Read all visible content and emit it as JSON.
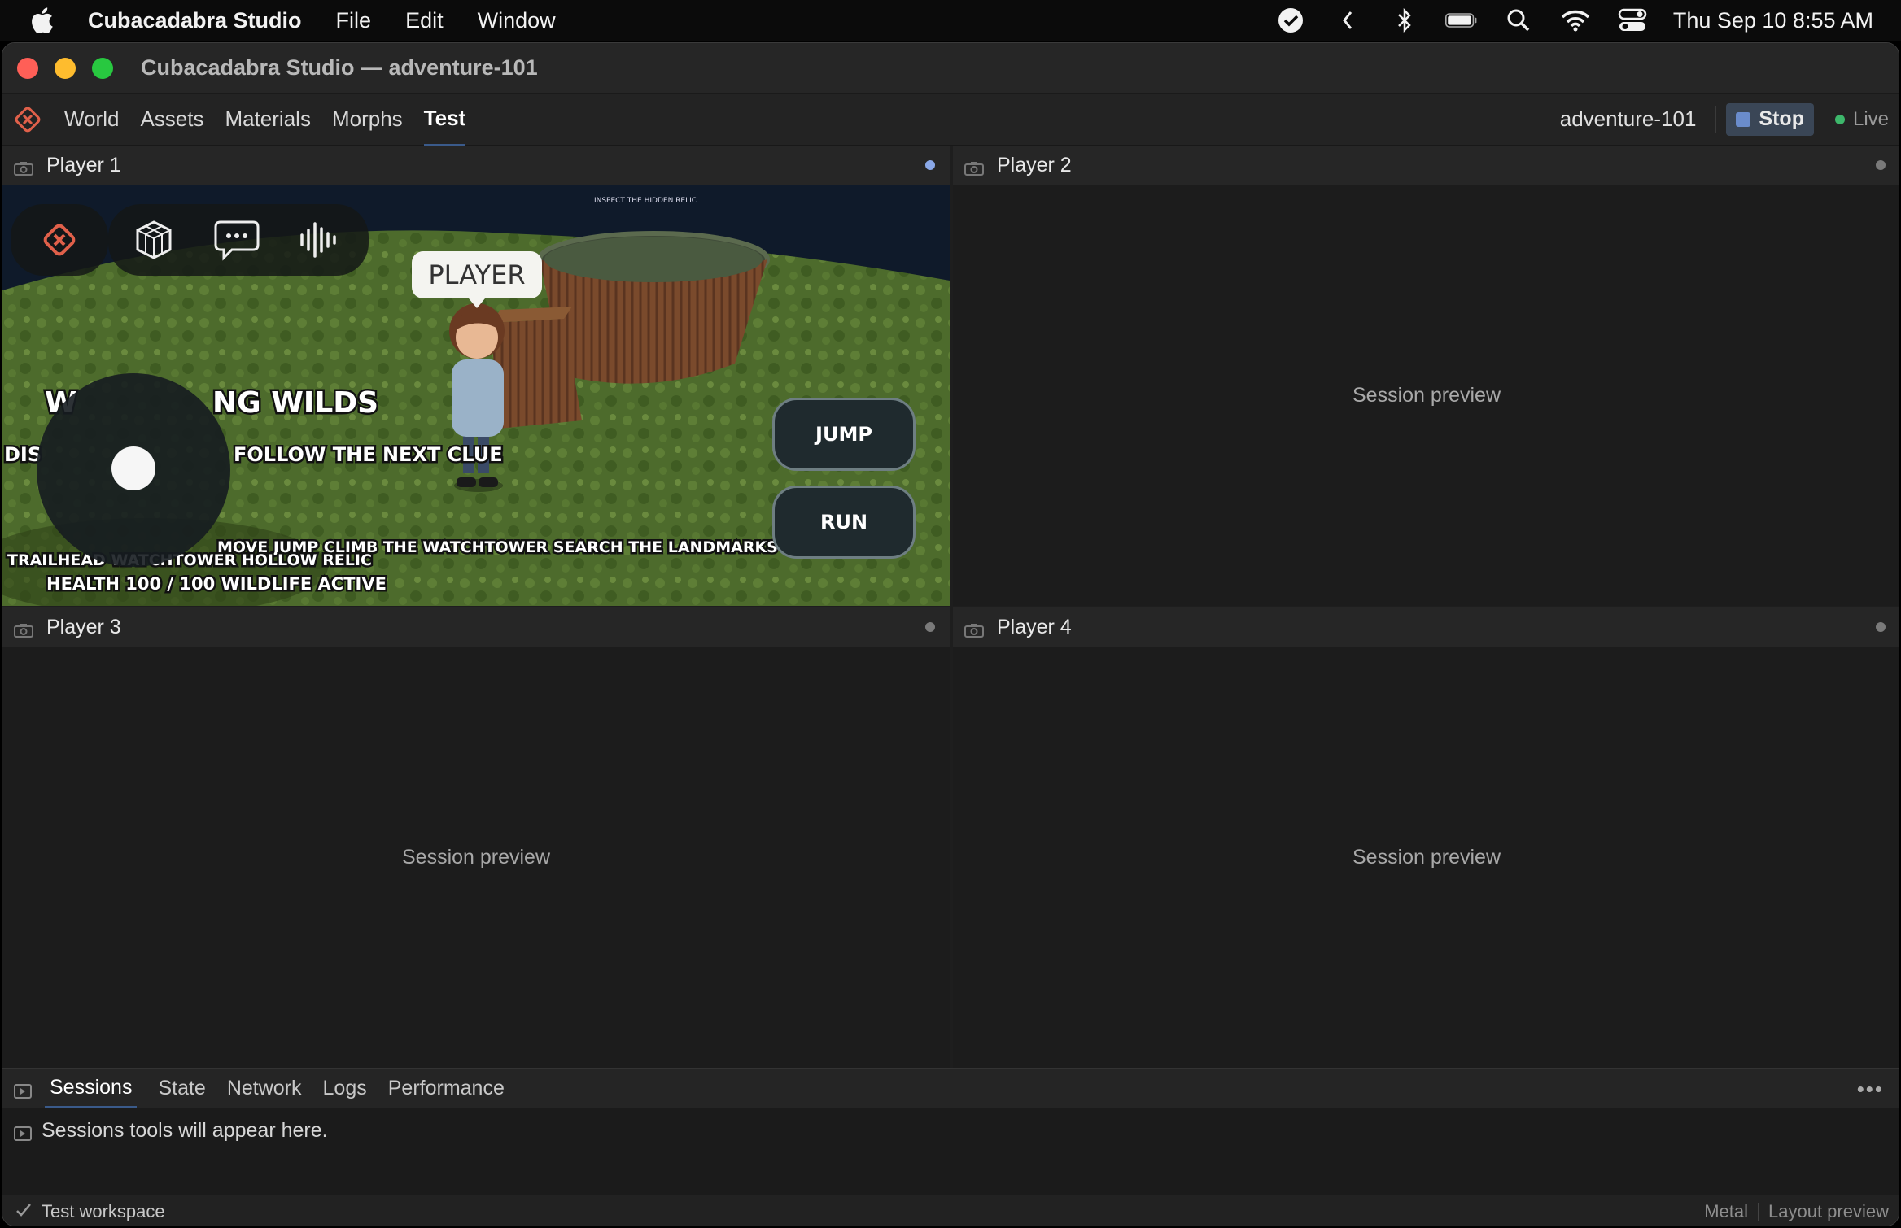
{
  "menubar": {
    "app_name": "Cubacadabra Studio",
    "menus": [
      "File",
      "Edit",
      "Window"
    ],
    "clock": "Thu Sep 10  8:55 AM",
    "status_icons": [
      "checkmark-circle-icon",
      "chevron-left-icon",
      "bluetooth-icon",
      "battery-icon",
      "spotlight-search-icon",
      "wifi-icon",
      "control-center-icon"
    ]
  },
  "window": {
    "title": "Cubacadabra Studio — adventure-101"
  },
  "toolbar": {
    "tabs": [
      "World",
      "Assets",
      "Materials",
      "Morphs",
      "Test"
    ],
    "active_tab": "Test",
    "project": "adventure-101",
    "stop_label": "Stop",
    "live_label": "Live"
  },
  "panes": [
    {
      "title": "Player 1",
      "active": true
    },
    {
      "title": "Player 2",
      "placeholder": "Session preview"
    },
    {
      "title": "Player 3",
      "placeholder": "Session preview"
    },
    {
      "title": "Player 4",
      "placeholder": "Session preview"
    }
  ],
  "game": {
    "player_tag": "PLAYER",
    "title_fragment": "NG WILDS",
    "title_prefix": "W",
    "objective": "FOLLOW THE NEXT CLUE",
    "left_fragment": "DIS",
    "hints": "MOVE  JUMP  CLIMB THE WATCHTOWER  SEARCH THE LANDMARKS",
    "landmarks": "TRAILHEAD     WATCHTOWER  HOLLOW  RELIC",
    "status": "HEALTH 100 / 100  WILDLIFE ACTIVE",
    "sign_text": "INSPECT THE HIDDEN RELIC",
    "jump_label": "JUMP",
    "run_label": "RUN"
  },
  "bottom": {
    "tabs": [
      "Sessions",
      "State",
      "Network",
      "Logs",
      "Performance"
    ],
    "active_tab": "Sessions",
    "more": "•••",
    "message": "Sessions tools will appear here."
  },
  "statusbar": {
    "left": "Test workspace",
    "right": [
      "Metal",
      "Layout preview"
    ]
  },
  "colors": {
    "accent": "#3a5a8a",
    "live": "#3db76b",
    "grass": "#4a6a2a"
  }
}
